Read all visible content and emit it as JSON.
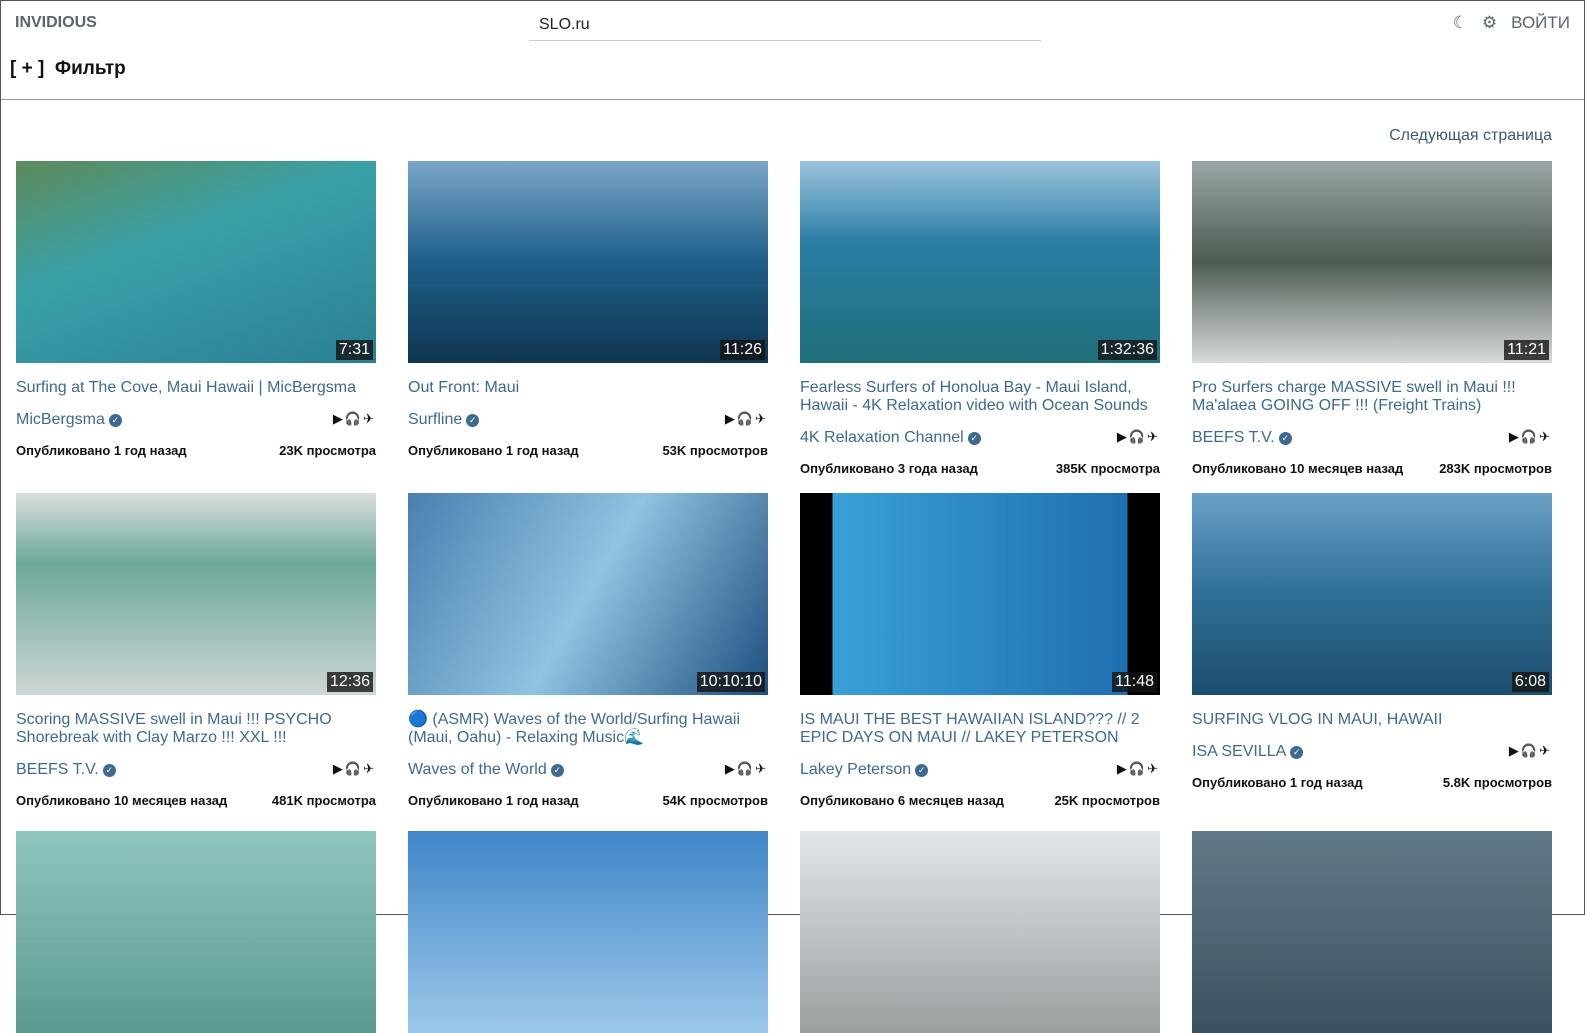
{
  "header": {
    "logo": "INVIDIOUS",
    "search_value": "SLO.ru",
    "login": "ВОЙТИ",
    "theme_icon": "moon-icon",
    "settings_icon": "gear-icon"
  },
  "filter": {
    "label": "[ + ]  Фильтр"
  },
  "pagination": {
    "next": "Следующая страница"
  },
  "videos": [
    {
      "title": "Surfing at The Cove, Maui Hawaii | MicBergsma",
      "channel": "MicBergsma",
      "duration": "7:31",
      "published": "Опубликовано 1 год назад",
      "views": "23K просмотра",
      "bg": "linear-gradient(160deg,#5d8a5a,#3aa1a8 40%,#2a7f94)"
    },
    {
      "title": "Out Front: Maui",
      "channel": "Surfline",
      "duration": "11:26",
      "published": "Опубликовано 1 год назад",
      "views": "53K просмотров",
      "bg": "linear-gradient(180deg,#7aa6c9,#1e5f8a 50%,#0f3550)"
    },
    {
      "title": "Fearless Surfers of Honolua Bay - Maui Island, Hawaii - 4K Relaxation video with Ocean Sounds",
      "channel": "4K Relaxation Channel",
      "duration": "1:32:36",
      "published": "Опубликовано 3 года назад",
      "views": "385K просмотра",
      "bg": "linear-gradient(180deg,#9cc4de,#2b7ea6 40%,#1f6e7a)"
    },
    {
      "title": "Pro Surfers charge MASSIVE swell in Maui !!! Ma'alaea GOING OFF !!! (Freight Trains)",
      "channel": "BEEFS T.V.",
      "duration": "11:21",
      "published": "Опубликовано 10 месяцев назад",
      "views": "283K просмотров",
      "bg": "linear-gradient(180deg,#9aa5a6,#4e5c52 50%,#d8dcdc)"
    },
    {
      "title": "Scoring MASSIVE swell in Maui !!! PSYCHO Shorebreak with Clay Marzo !!! XXL !!!",
      "channel": "BEEFS T.V.",
      "duration": "12:36",
      "published": "Опубликовано 10 месяцев назад",
      "views": "481K просмотра",
      "bg": "linear-gradient(180deg,#d9dede,#6ba89a 35%,#cfd6d6)"
    },
    {
      "title": "🔵 (ASMR) Waves of the World/Surfing Hawaii (Maui, Oahu) - Relaxing Music🌊",
      "channel": "Waves of the World",
      "duration": "10:10:10",
      "published": "Опубликовано 1 год назад",
      "views": "54K просмотров",
      "bg": "linear-gradient(120deg,#4a7fb0,#8fc3e0 50%,#1d4f80)"
    },
    {
      "title": "IS MAUI THE BEST HAWAIIAN ISLAND??? // 2 EPIC DAYS ON MAUI // LAKEY PETERSON",
      "channel": "Lakey Peterson",
      "duration": "11:48",
      "published": "Опубликовано 6 месяцев назад",
      "views": "25K просмотров",
      "bg": "linear-gradient(90deg,#000 9%,#3aa0d8 9%,#1f6fb0 91%,#000 91%)"
    },
    {
      "title": "SURFING VLOG IN MAUI, HAWAII",
      "channel": "ISA SEVILLA",
      "duration": "6:08",
      "published": "Опубликовано 1 год назад",
      "views": "5.8K просмотров",
      "bg": "linear-gradient(180deg,#6aa0c8,#2f6f96 50%,#1c4d6e)"
    },
    {
      "bg": "linear-gradient(180deg,#8fc6c0,#5a9a90)"
    },
    {
      "bg": "linear-gradient(180deg,#3f86c8,#9cc8ea)"
    },
    {
      "bg": "linear-gradient(180deg,#e2e6ea,#9aa0a0)"
    },
    {
      "bg": "linear-gradient(180deg,#5f7a86,#3b5360)"
    }
  ]
}
